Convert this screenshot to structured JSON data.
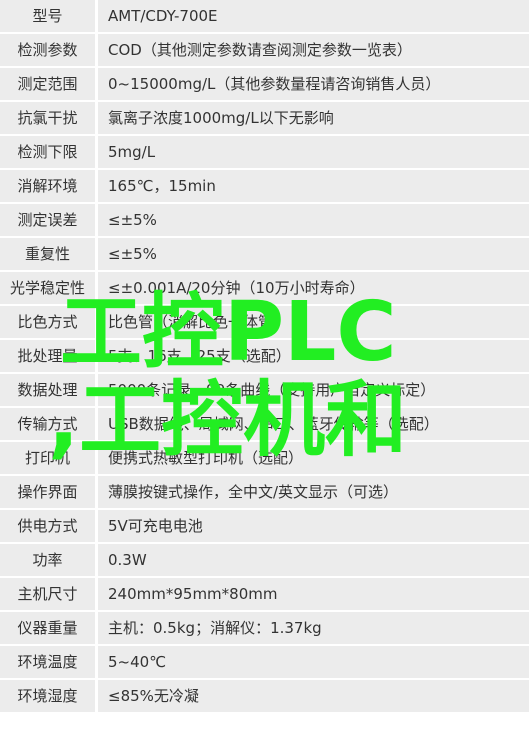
{
  "rows": [
    {
      "label": "型号",
      "value": "AMT/CDY-700E"
    },
    {
      "label": "检测参数",
      "value": "COD（其他测定参数请查阅测定参数一览表）"
    },
    {
      "label": "测定范围",
      "value": "0~15000mg/L（其他参数量程请咨询销售人员）"
    },
    {
      "label": "抗氯干扰",
      "value": "氯离子浓度1000mg/L以下无影响"
    },
    {
      "label": "检测下限",
      "value": "5mg/L"
    },
    {
      "label": "消解环境",
      "value": "165℃，15min"
    },
    {
      "label": "测定误差",
      "value": "≤±5%"
    },
    {
      "label": "重复性",
      "value": "≤±5%"
    },
    {
      "label": "光学稳定性",
      "value": "≤±0.001A/20分钟（10万小时寿命）"
    },
    {
      "label": "比色方式",
      "value": "比色管（消解比色一体管）"
    },
    {
      "label": "批处理量",
      "value": "5支、16支、25支（选配）"
    },
    {
      "label": "数据处理",
      "value": "5000条记录、99条曲线（支持用户自定义标定）"
    },
    {
      "label": "传输方式",
      "value": "USB数据线、局域网、串口、蓝牙传输等（选配）"
    },
    {
      "label": "打印机",
      "value": "便携式热敏型打印机（选配）"
    },
    {
      "label": "操作界面",
      "value": "薄膜按键式操作，全中文/英文显示（可选）"
    },
    {
      "label": "供电方式",
      "value": "5V可充电电池"
    },
    {
      "label": "功率",
      "value": "0.3W"
    },
    {
      "label": "主机尺寸",
      "value": "240mm*95mm*80mm"
    },
    {
      "label": "仪器重量",
      "value": "主机：0.5kg；消解仪：1.37kg"
    },
    {
      "label": "环境温度",
      "value": "5~40℃"
    },
    {
      "label": "环境湿度",
      "value": "≤85%无冷凝"
    }
  ],
  "watermark": {
    "line1": "工控PLC",
    "line2": ",工控机和",
    "color": "#22ee22"
  }
}
